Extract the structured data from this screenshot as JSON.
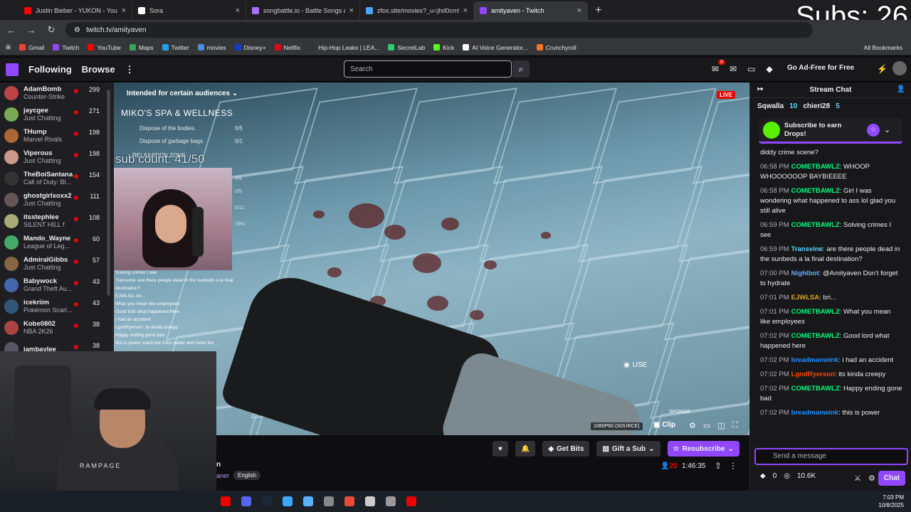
{
  "browser": {
    "tabs": [
      {
        "title": "Justin Bieber - YUKON - YouTube",
        "color": "#ff0000"
      },
      {
        "title": "Sora",
        "color": "#ffffff"
      },
      {
        "title": "songbattle.io - Battle Songs agai",
        "color": "#a970ff"
      },
      {
        "title": "zfox.site/movies?_u=jhd0crn5s",
        "color": "#4aa3ff"
      },
      {
        "title": "amityaven - Twitch",
        "color": "#9147ff"
      }
    ],
    "url": "twitch.tv/amityaven",
    "bookmarks": [
      {
        "label": "Gmail",
        "color": "#ea4335"
      },
      {
        "label": "Twitch",
        "color": "#9147ff"
      },
      {
        "label": "YouTube",
        "color": "#ff0000"
      },
      {
        "label": "Maps",
        "color": "#34a853"
      },
      {
        "label": "Twitter",
        "color": "#1da1f2"
      },
      {
        "label": "movies",
        "color": "#4a90d9"
      },
      {
        "label": "Disney+",
        "color": "#113ccf"
      },
      {
        "label": "Netflix",
        "color": "#e50914"
      },
      {
        "label": "Hip-Hop Leaks | LEA...",
        "color": "#333333"
      },
      {
        "label": "SecretLab",
        "color": "#2ecc71"
      },
      {
        "label": "Kick",
        "color": "#53fc18"
      },
      {
        "label": "AI Voice Generator...",
        "color": "#ffffff"
      },
      {
        "label": "Crunchyroll",
        "color": "#f47521"
      }
    ],
    "all_bookmarks": "All Bookmarks"
  },
  "overlay_subs": "Subs: 26",
  "twitch_nav": {
    "following": "Following",
    "browse": "Browse",
    "search_placeholder": "Search",
    "notif_count": "8",
    "ad_free": "Go Ad-Free for Free"
  },
  "sidebar": [
    {
      "name": "AdamBomb",
      "game": "Counter-Strike",
      "viewers": "299"
    },
    {
      "name": "jaycgee",
      "game": "Just Chatting",
      "viewers": "271"
    },
    {
      "name": "THump",
      "game": "Marvel Rivals",
      "viewers": "198"
    },
    {
      "name": "Viperous",
      "game": "Just Chatting",
      "viewers": "198"
    },
    {
      "name": "TheBoiSantana",
      "game": "Call of Duty: Bl...",
      "viewers": "154"
    },
    {
      "name": "ghostgirlxoxx2",
      "game": "Just Chatting",
      "viewers": "111"
    },
    {
      "name": "itsstephlee",
      "game": "SILENT HILL f",
      "viewers": "108"
    },
    {
      "name": "Mando_Wayne",
      "game": "League of Leg...",
      "viewers": "60"
    },
    {
      "name": "AdmiralGibbs",
      "game": "Just Chatting",
      "viewers": "57"
    },
    {
      "name": "Babywock",
      "game": "Grand Theft Au...",
      "viewers": "43"
    },
    {
      "name": "icekriim",
      "game": "Pokémon Scarl...",
      "viewers": "43"
    },
    {
      "name": "Kobe0802",
      "game": "NBA 2K26",
      "viewers": "38"
    },
    {
      "name": "iambaylee",
      "game": "",
      "viewers": "38"
    }
  ],
  "video": {
    "audience": "Intended for certain audiences",
    "live": "LIVE",
    "quest_title": "MIKO'S SPA & WELLNESS",
    "tasks": [
      {
        "label": "Dispose of the bodies.",
        "count": "0/5"
      },
      {
        "label": "Dispose of garbage bags",
        "count": "0/1"
      }
    ],
    "zone": "RELAXATION ZONE",
    "zone_sub": "Empty the pool",
    "sub_count": "sub count: 41/50",
    "stats": [
      "3%",
      "0/5",
      "0/11",
      "78%"
    ],
    "chat_overlay": [
      "Solving crimes I see",
      "Transvine: are there people dead in the sunbeds a la final destination?",
      "EJWLSA: bri...",
      "What you mean like employees",
      "Good lord what happened here",
      "I had an accident",
      "LgndRyerson: its kinda creepy",
      "Happy ending gone bad",
      "this is power wash but 100x better and more fun"
    ],
    "use_label": "USE",
    "sponge_label": "SPONGE",
    "quality": "1080P60 (SOURCE)",
    "clip": "Clip"
  },
  "below_video": {
    "language": "English",
    "get_bits": "Get Bits",
    "gift_sub": "Gift a Sub",
    "resubscribe": "Resubscribe",
    "viewers": "20",
    "uptime": "1:46:35",
    "title_fragment": "n",
    "tag_fragment": "aner"
  },
  "chat": {
    "header": "Stream Chat",
    "gifters": [
      {
        "name": "Sqwalla",
        "count": ""
      },
      {
        "name": "",
        "count": "10"
      },
      {
        "name": "chieri28",
        "count": ""
      },
      {
        "name": "",
        "count": "5"
      }
    ],
    "drops": "Subscribe to earn Drops!",
    "messages": [
      {
        "time": "",
        "user": "",
        "color": "#ff4500",
        "text": "diddy crime scene?"
      },
      {
        "time": "06:58 PM",
        "user": "COMETBAWLZ",
        "color": "#00ff7f",
        "text": "WHOOP WHOOOOOOP BAYBIEEEE"
      },
      {
        "time": "06:58 PM",
        "user": "COMETBAWLZ",
        "color": "#00ff7f",
        "text": "Girl I was wondering what happened to  ass lol glad you still alive"
      },
      {
        "time": "06:59 PM",
        "user": "COMETBAWLZ",
        "color": "#00ff7f",
        "text": "Solving crimes I see"
      },
      {
        "time": "06:59 PM",
        "user": "Transvine",
        "color": "#5fd7ff",
        "text": "are there people dead in the sunbeds a la final destination?"
      },
      {
        "time": "07:00 PM",
        "user": "Nightbot",
        "color": "#6fa8ff",
        "text": "@Amityaven Don't forget to hydrate"
      },
      {
        "time": "07:01 PM",
        "user": "EJWLSA",
        "color": "#daa520",
        "text": "bri..."
      },
      {
        "time": "07:01 PM",
        "user": "COMETBAWLZ",
        "color": "#00ff7f",
        "text": "What you mean like employees"
      },
      {
        "time": "07:02 PM",
        "user": "COMETBAWLZ",
        "color": "#00ff7f",
        "text": "Good lord what happened here"
      },
      {
        "time": "07:02 PM",
        "user": "breadmanwink",
        "color": "#1e90ff",
        "text": "i had an accident"
      },
      {
        "time": "07:02 PM",
        "user": "LgndRyerson",
        "color": "#ff4500",
        "text": "its kinda creepy"
      },
      {
        "time": "07:02 PM",
        "user": "COMETBAWLZ",
        "color": "#00ff7f",
        "text": "Happy ending gone bad"
      },
      {
        "time": "07:02 PM",
        "user": "breadmanwink",
        "color": "#1e90ff",
        "text": "this is power"
      }
    ],
    "send_placeholder": "Send a message",
    "points": "0",
    "channel_points": "10.6K",
    "chat_button": "Chat"
  },
  "taskbar": {
    "time": "7:03 PM",
    "date": "10/8/2025"
  },
  "accent": "#9147ff"
}
